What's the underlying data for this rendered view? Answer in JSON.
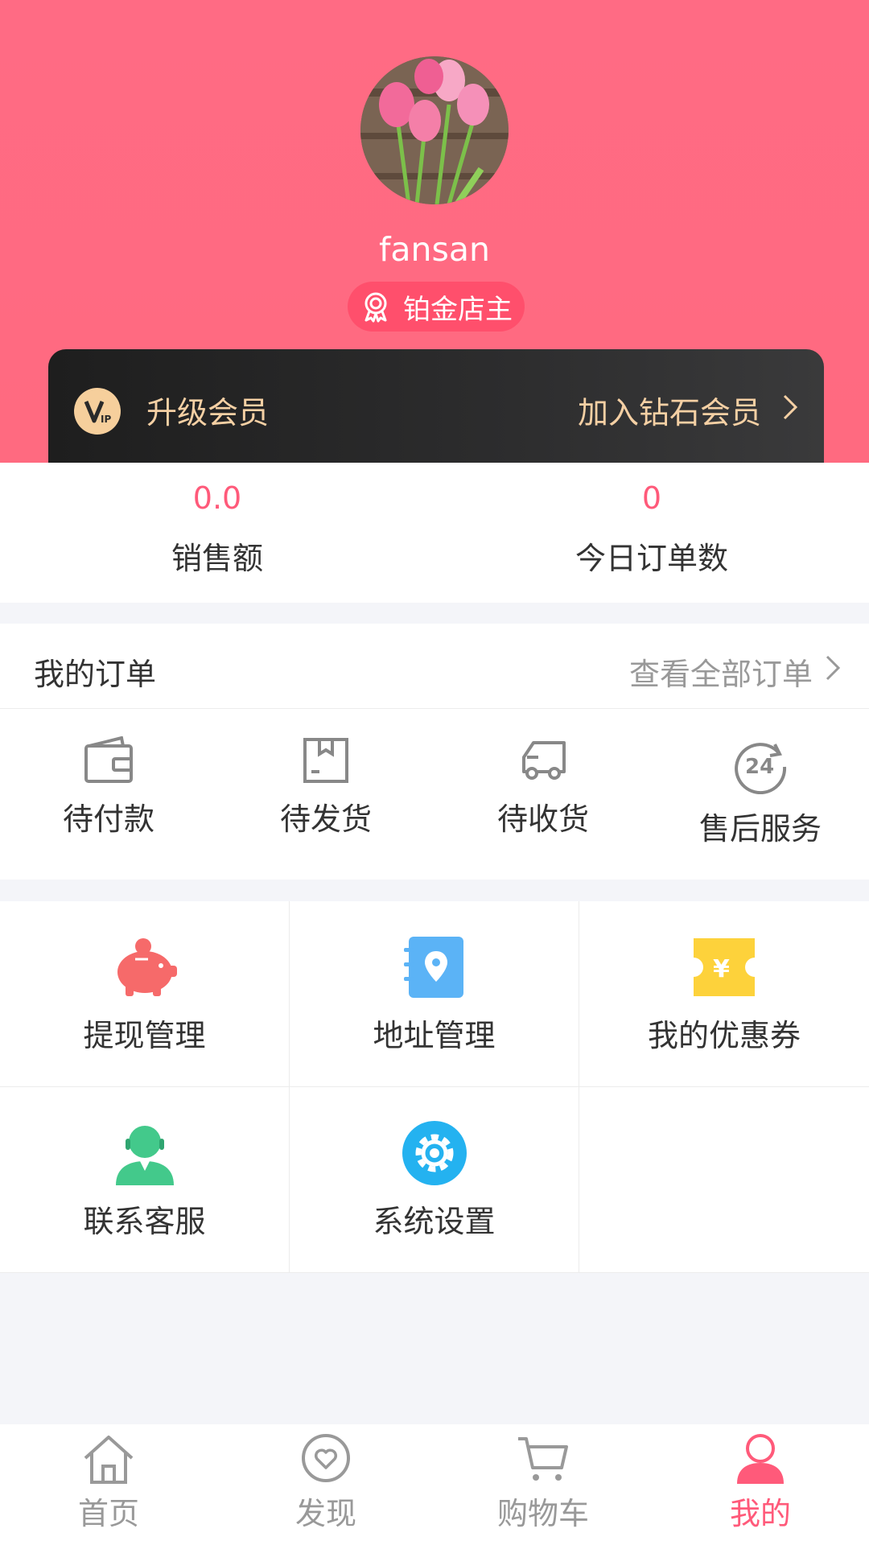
{
  "profile": {
    "username": "fansan",
    "level": "铂金店主"
  },
  "vip": {
    "label": "升级会员",
    "join": "加入钻石会员"
  },
  "stats": [
    {
      "value": "0.0",
      "label": "销售额"
    },
    {
      "value": "0",
      "label": "今日订单数"
    }
  ],
  "orders": {
    "title": "我的订单",
    "view_all": "查看全部订单",
    "items": [
      {
        "label": "待付款",
        "icon": "wallet-icon"
      },
      {
        "label": "待发货",
        "icon": "box-icon"
      },
      {
        "label": "待收货",
        "icon": "truck-icon"
      },
      {
        "label": "售后服务",
        "icon": "24h-icon"
      }
    ]
  },
  "tools": [
    {
      "label": "提现管理",
      "icon": "piggy-bank-icon"
    },
    {
      "label": "地址管理",
      "icon": "address-book-icon"
    },
    {
      "label": "我的优惠券",
      "icon": "coupon-icon"
    },
    {
      "label": "联系客服",
      "icon": "customer-service-icon"
    },
    {
      "label": "系统设置",
      "icon": "settings-icon"
    }
  ],
  "tabs": [
    {
      "label": "首页",
      "icon": "home-icon"
    },
    {
      "label": "发现",
      "icon": "discover-icon"
    },
    {
      "label": "购物车",
      "icon": "cart-icon"
    },
    {
      "label": "我的",
      "icon": "user-icon"
    }
  ],
  "colors": {
    "accent": "#ff5a7a",
    "header": "#ff6b84",
    "vip_gold": "#f5d0a4"
  }
}
